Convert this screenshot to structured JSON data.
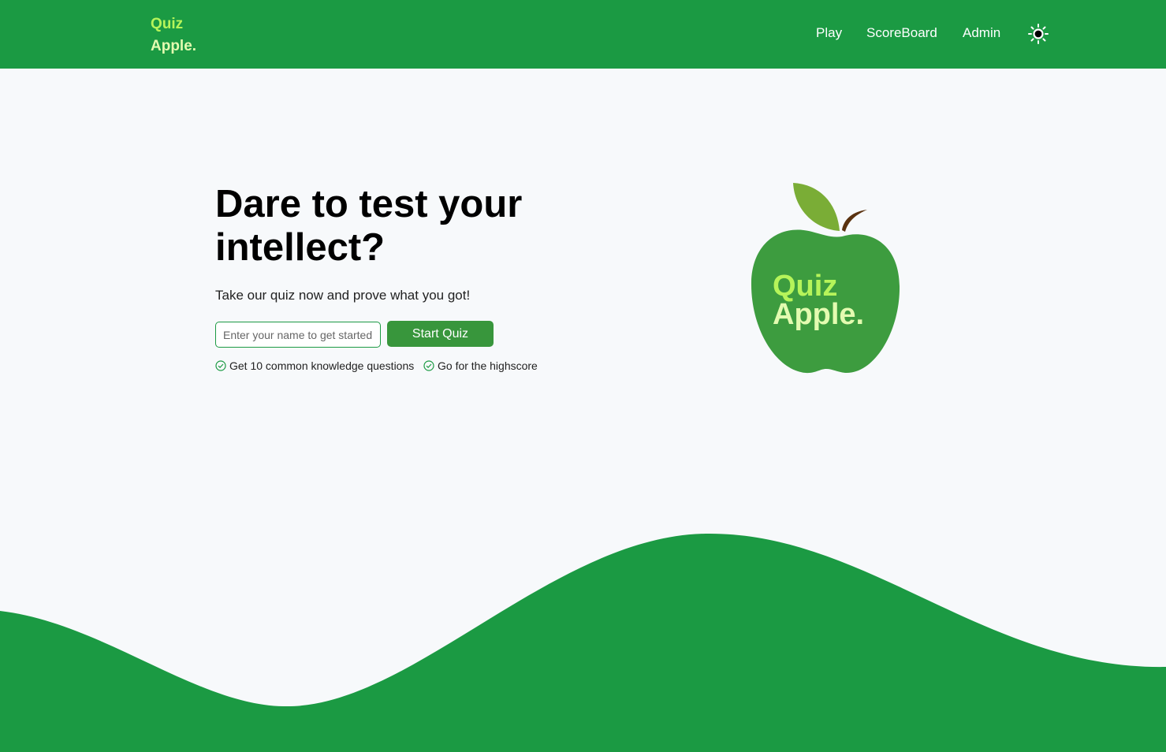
{
  "header": {
    "logo_line1": "Quiz",
    "logo_line2": "Apple.",
    "nav": {
      "play": "Play",
      "scoreboard": "ScoreBoard",
      "admin": "Admin"
    },
    "theme_icon": "sun-icon"
  },
  "hero": {
    "title": "Dare to test your intellect?",
    "subtitle": "Take our quiz now and prove what you got!",
    "name_placeholder": "Enter your name to get started..",
    "start_button": "Start Quiz",
    "features": [
      "Get 10 common knowledge questions",
      "Go for the highscore"
    ]
  },
  "illustration": {
    "line1": "Quiz",
    "line2": "Apple."
  },
  "colors": {
    "brand_green": "#1b9a43",
    "button_green": "#38963c",
    "apple_green": "#3d9c3f",
    "leaf_green": "#7aad36",
    "logo_lime": "#b6f45a",
    "logo_pale": "#e3fbb0"
  }
}
